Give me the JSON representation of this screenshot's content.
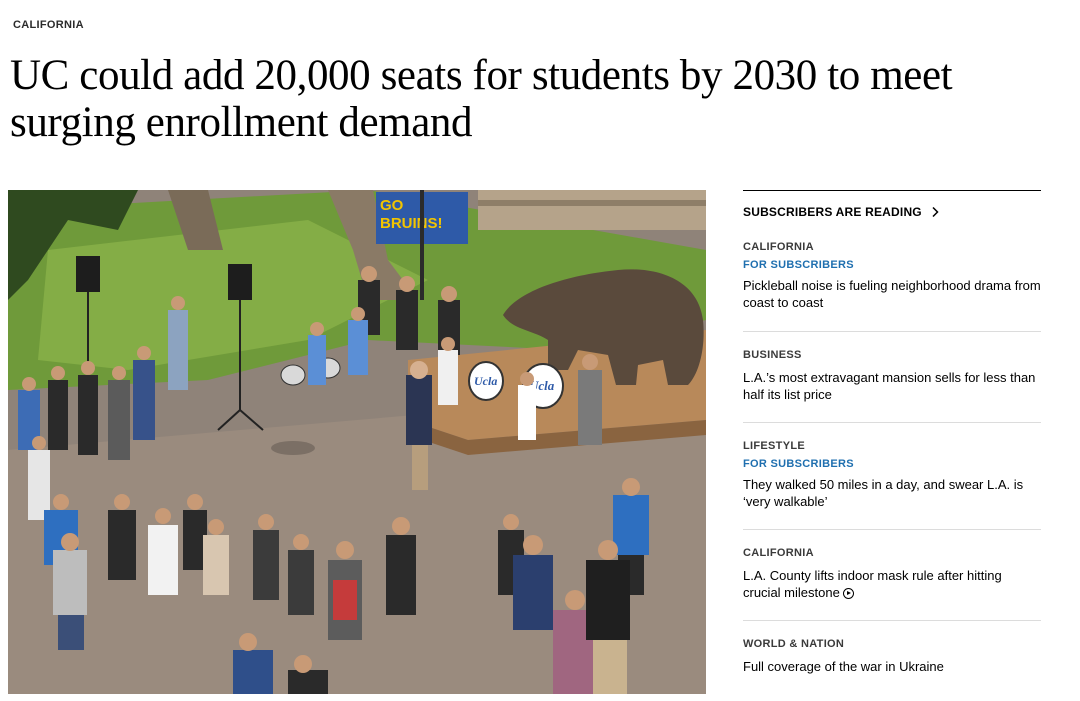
{
  "article": {
    "section": "CALIFORNIA",
    "headline": "UC could add 20,000 seats for students by 2030 to meet surging enrollment demand",
    "photo_banner_text": "GO BRUINS!",
    "drum_logo": "Ucla"
  },
  "sidebar": {
    "header": "SUBSCRIBERS ARE READING",
    "header_icon": "chevron-right-icon",
    "stories": [
      {
        "kicker": "CALIFORNIA",
        "subscriber_tag": "FOR SUBSCRIBERS",
        "title": "Pickleball noise is fueling neighborhood drama from coast to coast"
      },
      {
        "kicker": "BUSINESS",
        "subscriber_tag": "",
        "title": "L.A.’s most extravagant mansion sells for less than half its list price"
      },
      {
        "kicker": "LIFESTYLE",
        "subscriber_tag": "FOR SUBSCRIBERS",
        "title": "They walked 50 miles in a day, and swear L.A. is ‘very walkable’"
      },
      {
        "kicker": "CALIFORNIA",
        "subscriber_tag": "",
        "title": "L.A. County lifts indoor mask rule after hitting crucial milestone",
        "icon": "play-circle-icon"
      },
      {
        "kicker": "WORLD & NATION",
        "subscriber_tag": "",
        "title": "Full coverage of the war in Ukraine"
      }
    ]
  },
  "colors": {
    "subscriber_tag": "#1f6faf",
    "rule": "#000000",
    "divider": "#dcdcdc"
  }
}
